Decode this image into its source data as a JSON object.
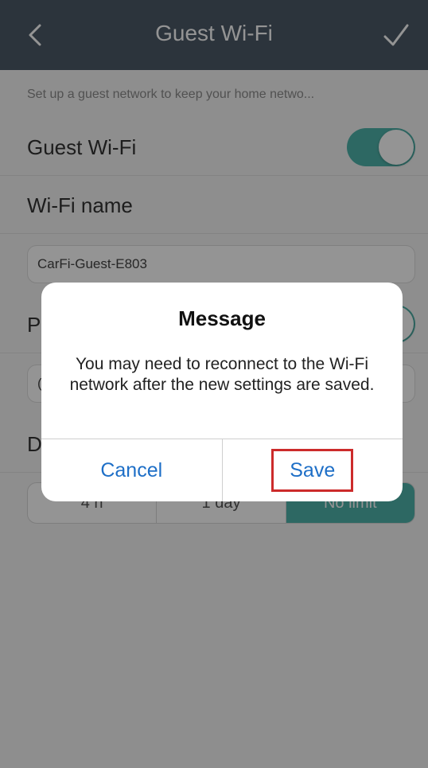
{
  "header": {
    "title": "Guest Wi-Fi",
    "back_icon": "chevron-left-icon",
    "confirm_icon": "checkmark-icon"
  },
  "info_text": "Set up a guest network to keep your home netwo...",
  "guest_wifi": {
    "label": "Guest Wi-Fi",
    "enabled": true
  },
  "wifi_name": {
    "label": "Wi-Fi name",
    "value": "CarFi-Guest-E803"
  },
  "password_row": {
    "label_visible": "P"
  },
  "password_input": {
    "value_visible": "("
  },
  "duration_row": {
    "label_visible": "D"
  },
  "duration_options": [
    "4 h",
    "1 day",
    "No limit"
  ],
  "dialog": {
    "title": "Message",
    "message": "You may need to reconnect to the Wi-Fi network after the new settings are saved.",
    "cancel_label": "Cancel",
    "save_label": "Save"
  },
  "colors": {
    "navbar": "#4c5a68",
    "accent": "#4fb3ab",
    "link": "#1e6fc7",
    "highlight": "#cc2b2b"
  }
}
